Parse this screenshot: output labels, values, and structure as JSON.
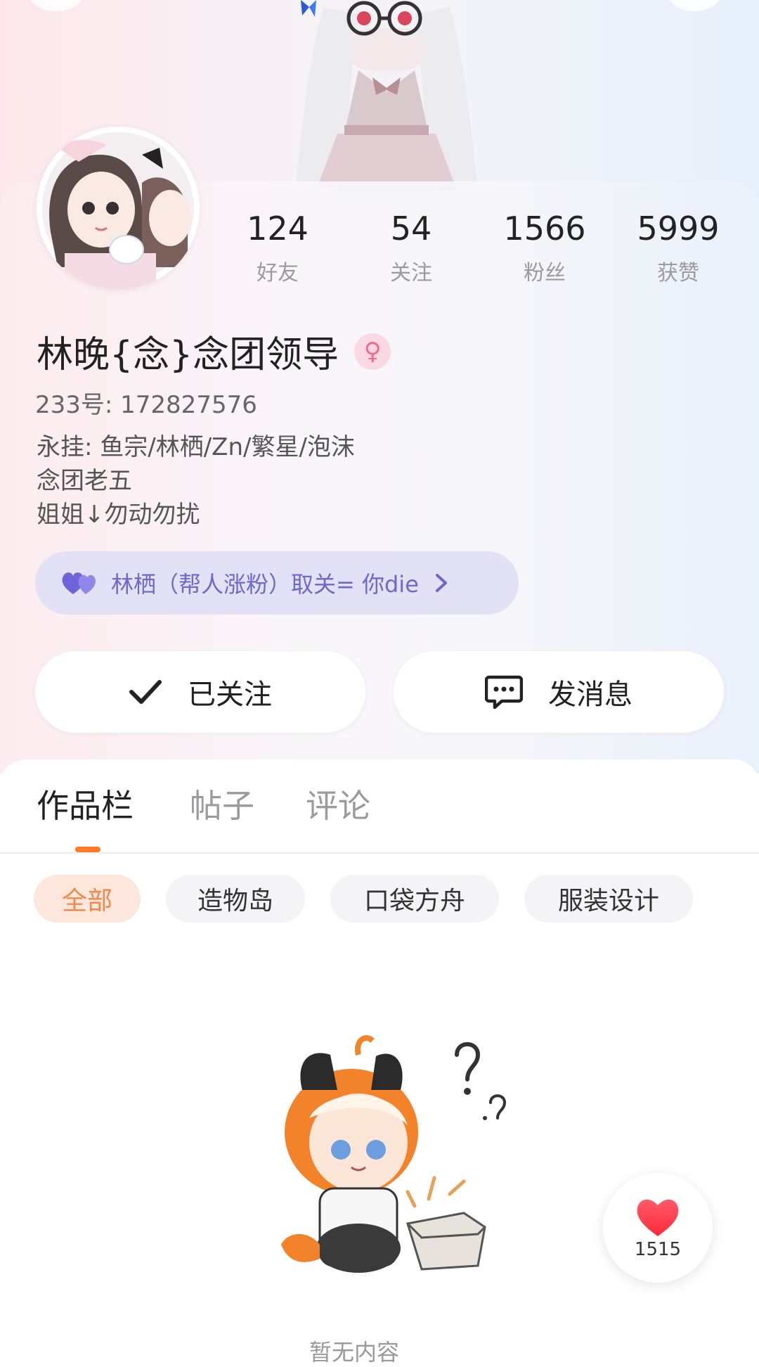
{
  "profile": {
    "stats": [
      {
        "value": "124",
        "label": "好友"
      },
      {
        "value": "54",
        "label": "关注"
      },
      {
        "value": "1566",
        "label": "粉丝"
      },
      {
        "value": "5999",
        "label": "获赞"
      }
    ],
    "name": "林晚{念}念团领导",
    "gender_icon": "female-icon",
    "uid": "233号: 172827576",
    "bio": [
      "永挂: 鱼宗/林栖/Zn/繁星/泡沫",
      "念团老五",
      "姐姐↓勿动勿扰"
    ],
    "fan_badge": "林栖（帮人涨粉）取关= 你die"
  },
  "actions": {
    "follow_label": "已关注",
    "message_label": "发消息"
  },
  "tabs": [
    {
      "label": "作品栏",
      "active": true
    },
    {
      "label": "帖子",
      "active": false
    },
    {
      "label": "评论",
      "active": false
    }
  ],
  "filters": [
    {
      "label": "全部",
      "active": true
    },
    {
      "label": "造物岛",
      "active": false
    },
    {
      "label": "口袋方舟",
      "active": false
    },
    {
      "label": "服装设计",
      "active": false
    }
  ],
  "empty_state": {
    "text": "暂无内容"
  },
  "like_button": {
    "count": "1515"
  },
  "colors": {
    "accent": "#ff7a26",
    "fan_badge_text": "#6e68c8",
    "heart": "#ff3b4f"
  }
}
